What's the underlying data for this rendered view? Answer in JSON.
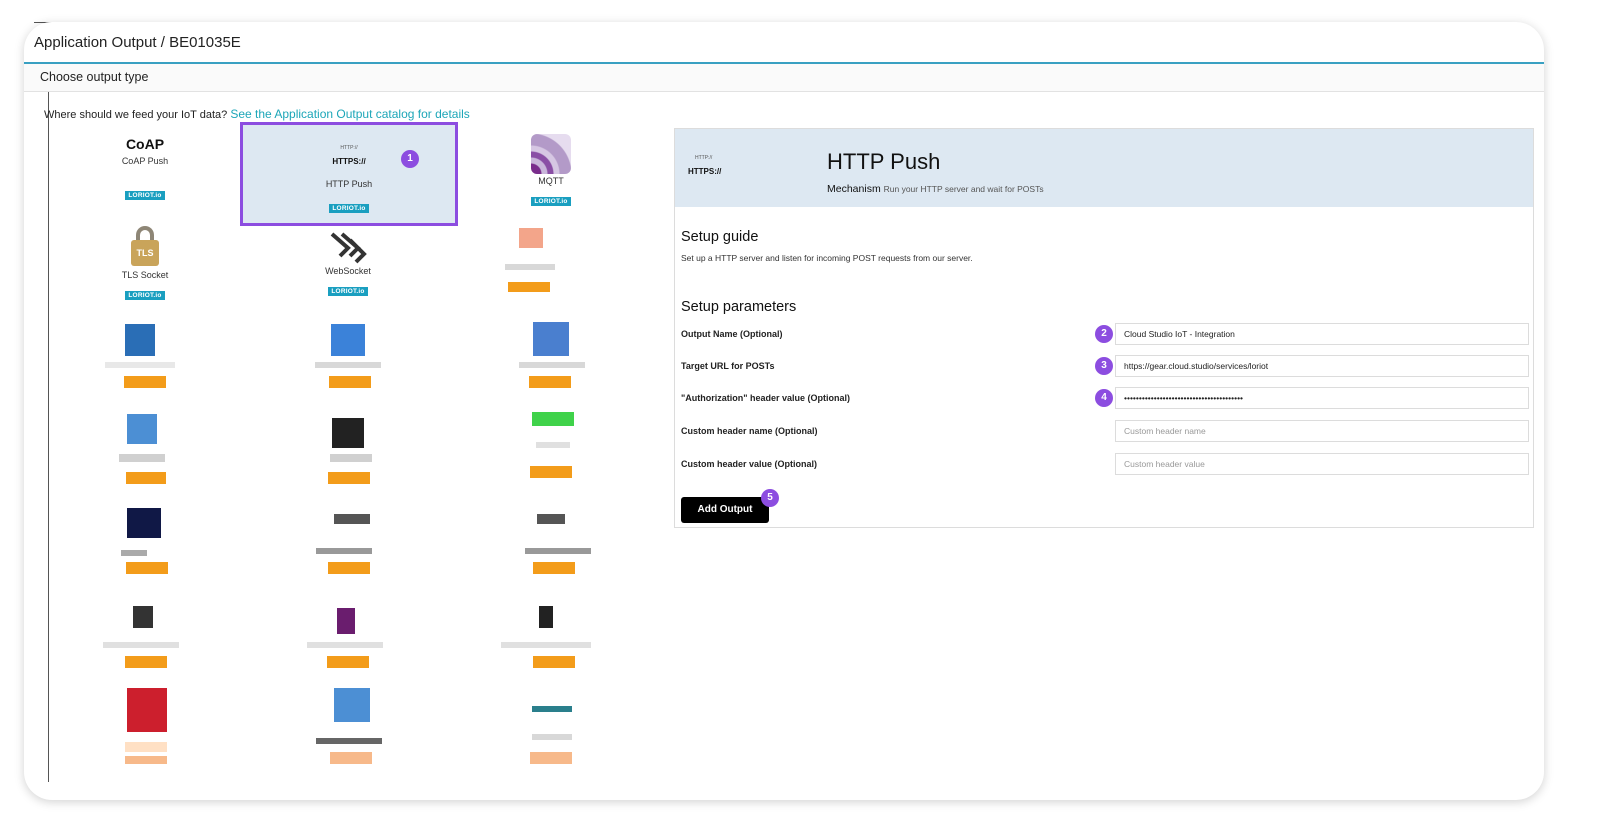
{
  "header": {
    "title": "Application Output / BE01035E"
  },
  "subheader": {
    "label": "Choose output type"
  },
  "prompt": {
    "text": "Where should we feed your IoT data?",
    "link": "See the Application Output catalog for details"
  },
  "outputs": [
    {
      "name": "CoAP",
      "label": "CoAP Push",
      "badge": "LORIOT.io"
    },
    {
      "small": "HTTP://",
      "name": "HTTPS://",
      "label": "HTTP Push",
      "badge": "LORIOT.io",
      "selected": true
    },
    {
      "label": "MQTT",
      "badge": "LORIOT.io"
    },
    {
      "label": "TLS Socket",
      "badge": "LORIOT.io",
      "icon_text": "TLS"
    },
    {
      "label": "WebSocket",
      "badge": "LORIOT.io"
    }
  ],
  "steps": [
    "1",
    "2",
    "3",
    "4",
    "5"
  ],
  "panel": {
    "small": "HTTP://",
    "https": "HTTPS://",
    "title": "HTTP Push",
    "mechanism_label": "Mechanism",
    "mechanism_text": "Run your HTTP server and wait for POSTs",
    "guide_title": "Setup guide",
    "guide_text": "Set up a HTTP server and listen for incoming POST requests from our server.",
    "params_title": "Setup parameters",
    "fields": [
      {
        "label": "Output Name (Optional)",
        "value": "Cloud Studio IoT - Integration"
      },
      {
        "label": "Target URL for POSTs",
        "value": "https://gear.cloud.studio/services/loriot"
      },
      {
        "label": "\"Authorization\" header value (Optional)",
        "value": "••••••••••••••••••••••••••••••••••••••••"
      },
      {
        "label": "Custom header name (Optional)",
        "placeholder": "Custom header name"
      },
      {
        "label": "Custom header value (Optional)",
        "placeholder": "Custom header value"
      }
    ],
    "submit_label": "Add Output"
  },
  "colors": {
    "accent": "#8c4de0",
    "link": "#1ca6b8",
    "badge": "#1a9fc0",
    "panel_head": "#dde8f2",
    "placeholder_tile": "#f39c1a"
  }
}
